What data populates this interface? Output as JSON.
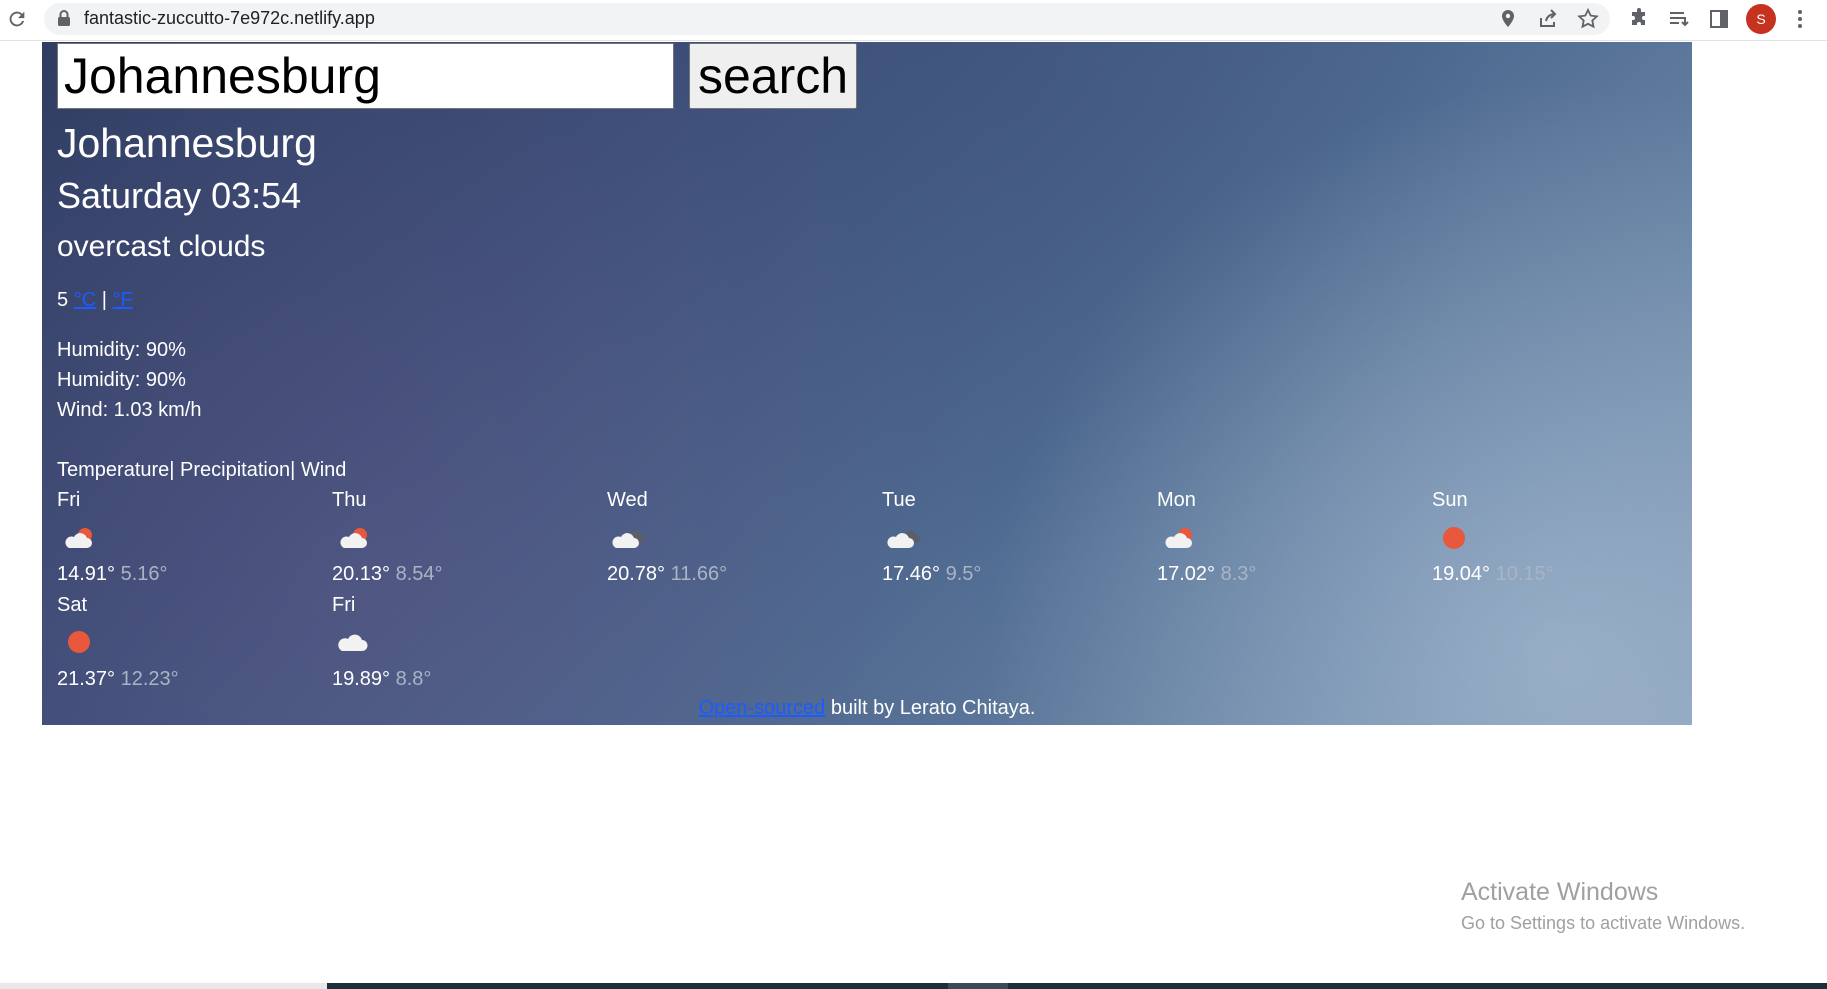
{
  "browser": {
    "url": "fantastic-zuccutto-7e972c.netlify.app",
    "profile_initial": "S"
  },
  "search": {
    "value": "Johannesburg",
    "button_label": "search"
  },
  "current": {
    "city": "Johannesburg",
    "datetime": "Saturday 03:54",
    "description": "overcast clouds",
    "temperature": "5",
    "unit_c": "°C",
    "separator": "|",
    "unit_f": "°F",
    "stats": [
      "Humidity: 90%",
      "Humidity: 90%",
      "Wind: 1.03 km/h"
    ]
  },
  "tabs_text": "Temperature| Precipitation| Wind",
  "forecast": [
    {
      "day": "Fri",
      "icon": "partly-cloudy-icon",
      "max": "14.91°",
      "min": "5.16°"
    },
    {
      "day": "Thu",
      "icon": "partly-cloudy-icon",
      "max": "20.13°",
      "min": "8.54°"
    },
    {
      "day": "Wed",
      "icon": "broken-clouds-icon",
      "max": "20.78°",
      "min": "11.66°"
    },
    {
      "day": "Tue",
      "icon": "broken-clouds-icon",
      "max": "17.46°",
      "min": "9.5°"
    },
    {
      "day": "Mon",
      "icon": "partly-cloudy-icon",
      "max": "17.02°",
      "min": "8.3°"
    },
    {
      "day": "Sun",
      "icon": "sun-icon",
      "max": "19.04°",
      "min": "10.15°"
    },
    {
      "day": "Sat",
      "icon": "sun-icon",
      "max": "21.37°",
      "min": "12.23°"
    },
    {
      "day": "Fri",
      "icon": "cloud-icon",
      "max": "19.89°",
      "min": "8.8°"
    }
  ],
  "footer": {
    "link_text": "Open-sourced",
    "text": " built by Lerato Chitaya."
  },
  "watermark": {
    "title": "Activate Windows",
    "subtitle": "Go to Settings to activate Windows."
  },
  "colors": {
    "sun": "#e8583c",
    "link": "#1a5cff",
    "min_temp": "#a9b4c4"
  }
}
